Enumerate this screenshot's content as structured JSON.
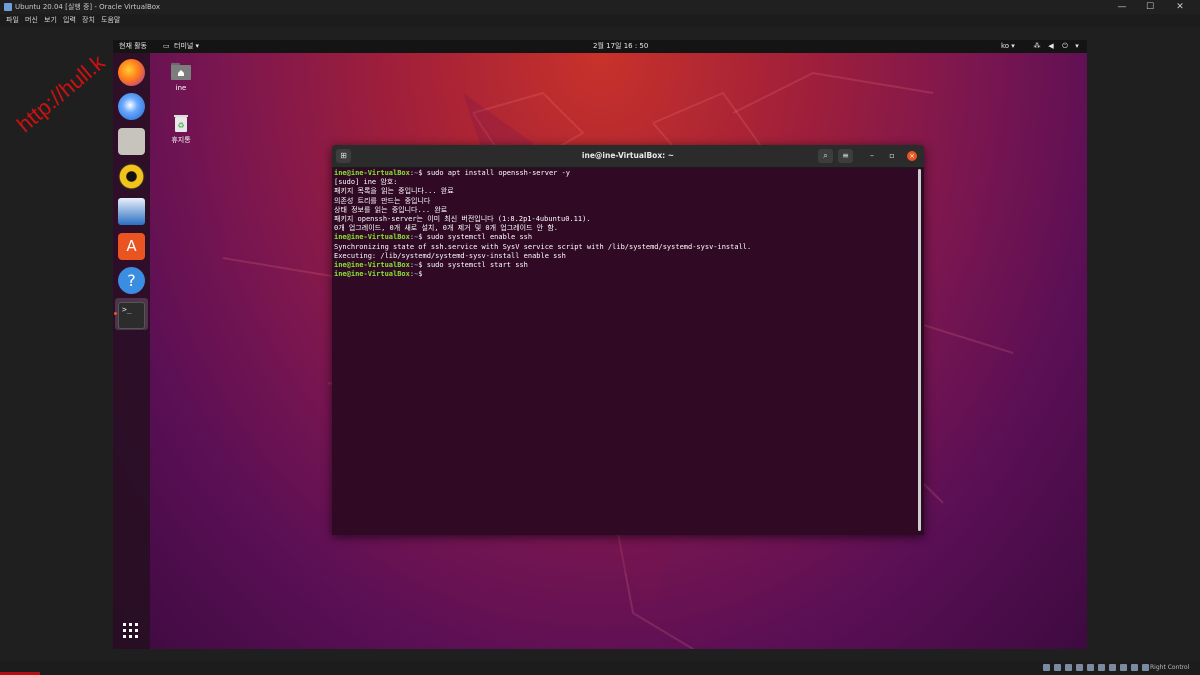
{
  "vbox": {
    "title": "Ubuntu 20.04 [실행 중] - Oracle VirtualBox",
    "minimize": "—",
    "maximize": "☐",
    "close": "✕",
    "menu": [
      "파일",
      "머신",
      "보기",
      "입력",
      "장치",
      "도움말"
    ]
  },
  "topbar": {
    "activities": "현재 활동",
    "app_menu": "터미널 ▾",
    "clock": "2월 17일  16 : 50",
    "input_method": "ko ▾"
  },
  "dock": {
    "apps": [
      "firefox",
      "thunderbird",
      "files",
      "rhythmbox",
      "libreoffice-writer",
      "ubuntu-software",
      "help",
      "terminal"
    ],
    "show_apps_icon": "grid-icon"
  },
  "desktop": {
    "icons": [
      {
        "label": "ine"
      },
      {
        "label": "휴지통"
      }
    ]
  },
  "terminal": {
    "title": "ine@ine-VirtualBox: ~",
    "lines": [
      {
        "prompt": "ine@ine-VirtualBox",
        "path": "~",
        "cmd": "$ sudo apt install openssh-server -y"
      },
      {
        "text": "[sudo] ine 암호:"
      },
      {
        "text": "패키지 목록을 읽는 중입니다... 완료"
      },
      {
        "text": "의존성 트리를 만드는 중입니다"
      },
      {
        "text": "상태 정보를 읽는 중입니다... 완료"
      },
      {
        "text": "패키지 openssh-server는 이미 최신 버전입니다 (1:8.2p1-4ubuntu0.11)."
      },
      {
        "text": "0개 업그레이드, 0개 새로 설치, 0개 제거 및 0개 업그레이드 안 함."
      },
      {
        "prompt": "ine@ine-VirtualBox",
        "path": "~",
        "cmd": "$ sudo systemctl enable ssh"
      },
      {
        "text": "Synchronizing state of ssh.service with SysV service script with /lib/systemd/systemd-sysv-install."
      },
      {
        "text": "Executing: /lib/systemd/systemd-sysv-install enable ssh"
      },
      {
        "prompt": "ine@ine-VirtualBox",
        "path": "~",
        "cmd": "$ sudo systemctl start ssh"
      },
      {
        "prompt": "ine@ine-VirtualBox",
        "path": "~",
        "cmd": "$ "
      }
    ]
  },
  "watermark": "http://hull.k",
  "statusbar": {
    "host_key": "Right Control"
  },
  "colors": {
    "accent": "#e95420",
    "terminal_bg": "#300a24",
    "prompt_green": "#8ae234",
    "path_blue": "#729fcf"
  }
}
